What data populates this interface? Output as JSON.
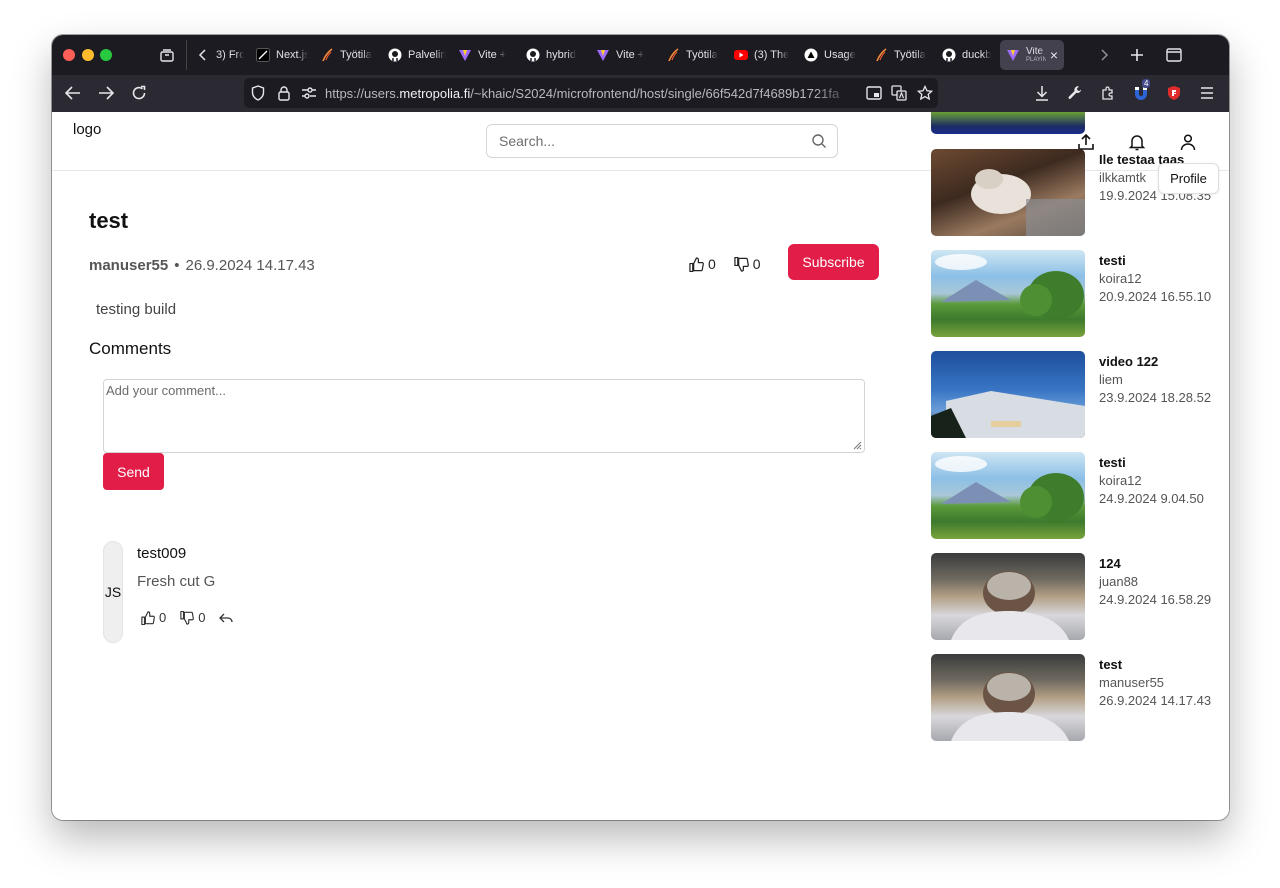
{
  "browser": {
    "tabs": [
      {
        "title": "3) Fro",
        "icon": "chevron-left-icon"
      },
      {
        "title": "Next.js",
        "icon": "nextjs-icon"
      },
      {
        "title": "Työtila",
        "icon": "pen-icon"
      },
      {
        "title": "Palvelin",
        "icon": "github-icon"
      },
      {
        "title": "Vite + ",
        "icon": "vite-icon"
      },
      {
        "title": "hybrid",
        "icon": "github-icon"
      },
      {
        "title": "Vite + ",
        "icon": "vite-icon"
      },
      {
        "title": "Työtila",
        "icon": "pen-icon"
      },
      {
        "title": "(3) The",
        "icon": "youtube-icon"
      },
      {
        "title": "Usage",
        "icon": "triangle-icon"
      },
      {
        "title": "Työtila",
        "icon": "pen-icon"
      },
      {
        "title": "duckb",
        "icon": "github-icon"
      }
    ],
    "active_tab": {
      "title": "Vite",
      "subtitle": "PLAYING"
    },
    "url_prefix": "https://users.",
    "url_domain": "metropolia.fi",
    "url_path": "/~khaic/S2024/microfrontend/host/single/66f542d7f4689b1721fa",
    "extension_badge": "4"
  },
  "header": {
    "logo": "logo",
    "search_placeholder": "Search...",
    "profile_tooltip": "Profile"
  },
  "video": {
    "title": "test",
    "author": "manuser55",
    "separator": "•",
    "date": "26.9.2024 14.17.43",
    "likes": "0",
    "dislikes": "0",
    "subscribe_label": "Subscribe",
    "description": "testing build"
  },
  "comments": {
    "heading": "Comments",
    "placeholder": "Add your comment...",
    "send_label": "Send",
    "items": [
      {
        "initials": "JS",
        "user": "test009",
        "text": "Fresh cut G",
        "likes": "0",
        "dislikes": "0"
      }
    ]
  },
  "sidebar": {
    "videos": [
      {
        "title": "Ile testaa taas",
        "user": "ilkkamtk",
        "date": "19.9.2024 15.08.35"
      },
      {
        "title": "testi",
        "user": "koira12",
        "date": "20.9.2024 16.55.10"
      },
      {
        "title": "video 122",
        "user": "liem",
        "date": "23.9.2024 18.28.52"
      },
      {
        "title": "testi",
        "user": "koira12",
        "date": "24.9.2024 9.04.50"
      },
      {
        "title": "124",
        "user": "juan88",
        "date": "24.9.2024 16.58.29"
      },
      {
        "title": "test",
        "user": "manuser55",
        "date": "26.9.2024 14.17.43"
      }
    ]
  },
  "colors": {
    "accent": "#e11d48",
    "browser_dark": "#1c1b22",
    "toolbar": "#2b2a33"
  }
}
